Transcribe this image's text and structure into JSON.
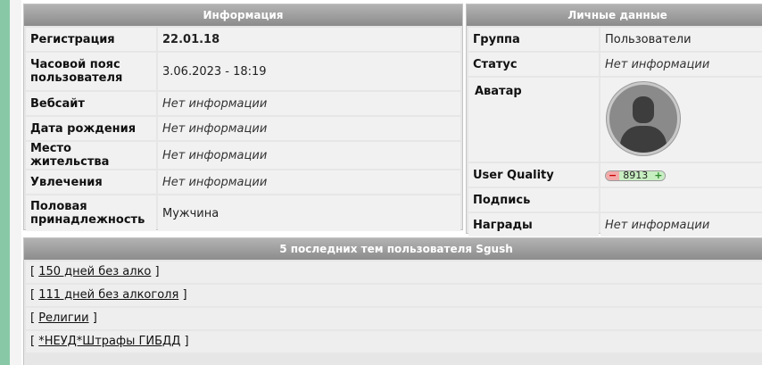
{
  "info": {
    "title": "Информация",
    "rows": [
      {
        "label": "Регистрация",
        "value": "22.01.18"
      },
      {
        "label": "Часовой пояс пользователя",
        "value": "3.06.2023 - 18:19"
      },
      {
        "label": "Вебсайт",
        "value": "Нет информации"
      },
      {
        "label": "Дата рождения",
        "value": "Нет информации"
      },
      {
        "label": "Место жительства",
        "value": "Нет информации"
      },
      {
        "label": "Увлечения",
        "value": "Нет информации"
      },
      {
        "label": "Половая принадлежность",
        "value": "Мужчина"
      }
    ]
  },
  "personal": {
    "title": "Личные данные",
    "group_label": "Группа",
    "group_value": "Пользователи",
    "status_label": "Статус",
    "status_value": "Нет информации",
    "avatar_label": "Аватар",
    "avatar_icon": "user-silhouette-icon",
    "uq_label": "User Quality",
    "uq_minus": "−",
    "uq_value": "8913",
    "uq_plus": "+",
    "signature_label": "Подпись",
    "signature_value": "",
    "awards_label": "Награды",
    "awards_value": "Нет информации"
  },
  "topics": {
    "title": "5 последних тем пользователя Sgush",
    "items": [
      "150 дней без алко",
      "111 дней без алкоголя",
      "Религии",
      "*НЕУД*Штрафы ГИБДД"
    ],
    "bracket_open": "[",
    "bracket_close": "]"
  },
  "colors": {
    "side_stripe": "#88c8a6",
    "header_gradient_top": "#b3b3b3",
    "header_gradient_bottom": "#8c8c8c",
    "uq_minus_bg": "#f3a9a9",
    "uq_value_bg": "#c7eec1"
  }
}
